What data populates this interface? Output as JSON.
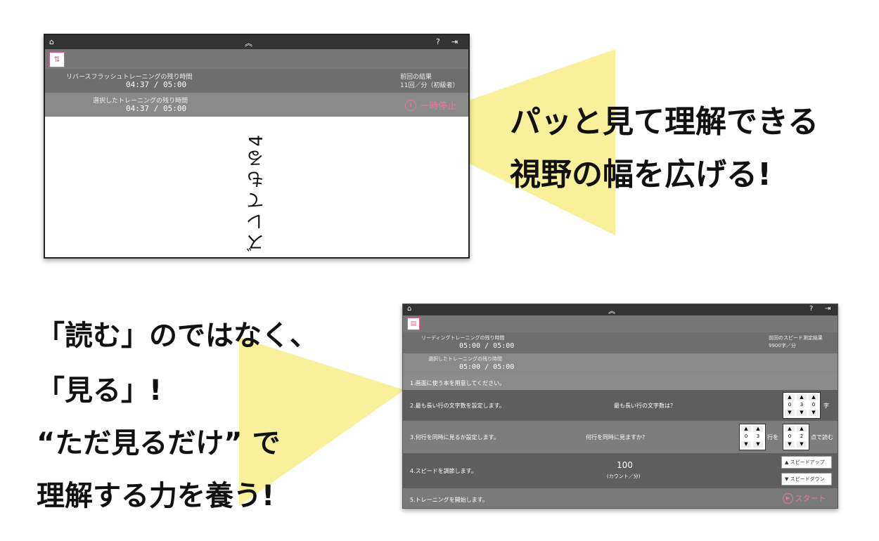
{
  "top_shot": {
    "home_icon": "home-icon",
    "collapse_icon": "double-chevron-up-icon",
    "help_icon": "help-icon",
    "exit_icon": "exit-icon",
    "mode_icon": "sort-arrows-icon",
    "remaining_label": "リバースフラッシュトレーニングの残り時間",
    "remaining_time": "04:37 / 05:00",
    "prev_label": "前回の結果",
    "prev_value": "11回／分（初級者）",
    "selected_label": "選択したトレーニングの残り時間",
    "selected_time": "04:37 / 05:00",
    "pause_label": "一時停止",
    "pause_icon": "pause-circle-icon",
    "display_text": "ズレてもる4"
  },
  "headline1": {
    "line1": "パッと見て理解できる",
    "line2": "視野の幅を広げる!"
  },
  "bottom_shot": {
    "home_icon": "home-icon",
    "collapse_icon": "double-chevron-up-icon",
    "help_icon": "help-icon",
    "exit_icon": "exit-icon",
    "mode_icon": "book-icon",
    "remaining_label": "リーディングトレーニングの残り時間",
    "remaining_time": "05:00 / 05:00",
    "prev_label": "前回のスピード測定結果",
    "prev_value": "9900字／分",
    "selected_label": "選択したトレーニングの残り時間",
    "selected_time": "05:00 / 05:00",
    "step1": "1.画面に使う本を用意してください。",
    "step2": "2.最も長い行の文字数を設定します。",
    "step2_q": "最も長い行の文字数は？",
    "step2_digits": [
      "0",
      "3",
      "0"
    ],
    "step2_unit": "字",
    "step3": "3.何行を同時に見るか設定します。",
    "step3_q": "何行を同時に見ますか？",
    "step3_a_digits": [
      "0",
      "3"
    ],
    "step3_a_unit": "行を",
    "step3_b_digits": [
      "0",
      "2"
    ],
    "step3_b_unit": "点で読む",
    "step4": "4.スピードを調節します。",
    "speed_value": "100",
    "speed_unit": "(カウント／分)",
    "speed_up": "スピードアップ",
    "speed_down": "スピードダウン",
    "step5": "5.トレーニングを開始します。",
    "start_label": "スタート",
    "start_icon": "play-circle-icon",
    "up_arrow": "▲",
    "down_arrow": "▼"
  },
  "headline2": {
    "line1": "「読む」のではなく、",
    "line2": "「見る」!",
    "line3": "“ただ見るだけ” で",
    "line4": "理解する力を養う!"
  },
  "colors": {
    "beam": "#f8f09a",
    "topbar": "#333333",
    "accent_pink": "#e0608a"
  }
}
